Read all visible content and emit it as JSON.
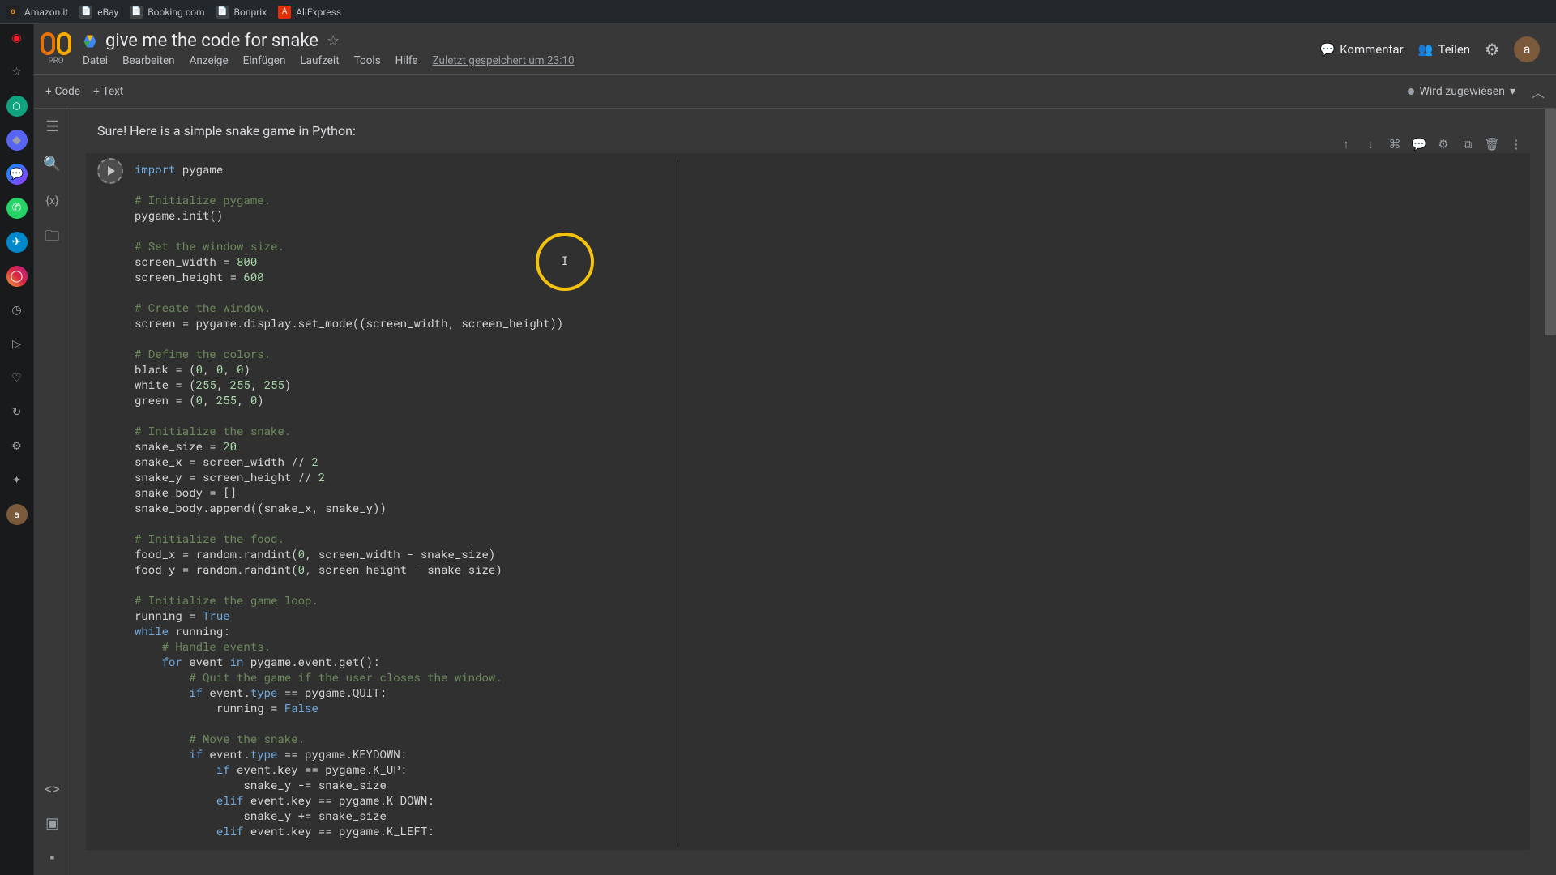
{
  "browser": {
    "bookmarks": [
      {
        "label": "Amazon.it"
      },
      {
        "label": "eBay"
      },
      {
        "label": "Booking.com"
      },
      {
        "label": "Bonprix"
      },
      {
        "label": "AliExpress"
      }
    ]
  },
  "header": {
    "pro_label": "PRO",
    "title": "give me the code for snake",
    "menu": {
      "file": "Datei",
      "edit": "Bearbeiten",
      "view": "Anzeige",
      "insert": "Einfügen",
      "runtime": "Laufzeit",
      "tools": "Tools",
      "help": "Hilfe",
      "autosave": "Zuletzt gespeichert um 23:10"
    },
    "actions": {
      "comment": "Kommentar",
      "share": "Teilen"
    },
    "avatar_letter": "a"
  },
  "toolbar": {
    "add_code": "Code",
    "add_text": "Text",
    "connect_status": "Wird zugewiesen"
  },
  "notebook": {
    "text_cell": "Sure! Here is a simple snake game in Python:",
    "highlight_caret": "I"
  },
  "code": {
    "l1_kw": "import",
    "l1_mod": " pygame",
    "l3": "# Initialize pygame.",
    "l4_a": "pygame.init",
    "l4_b": "()",
    "l6": "# Set the window size.",
    "l7_a": "screen_width ",
    "l7_b": "=",
    "l7_c": " 800",
    "l8_a": "screen_height ",
    "l8_b": "=",
    "l8_c": " 600",
    "l10": "# Create the window.",
    "l11_a": "screen ",
    "l11_b": "=",
    "l11_c": " pygame.display.set_mode",
    "l11_d": "((",
    "l11_e": "screen_width",
    "l11_f": ", ",
    "l11_g": "screen_height",
    "l11_h": "))",
    "l13": "# Define the colors.",
    "l14_a": "black ",
    "l14_b": "=",
    "l14_c": " (",
    "l14_d": "0",
    "l14_e": ", ",
    "l14_f": "0",
    "l14_g": ", ",
    "l14_h": "0",
    "l14_i": ")",
    "l15_a": "white ",
    "l15_b": "=",
    "l15_c": " (",
    "l15_d": "255",
    "l15_e": ", ",
    "l15_f": "255",
    "l15_g": ", ",
    "l15_h": "255",
    "l15_i": ")",
    "l16_a": "green ",
    "l16_b": "=",
    "l16_c": " (",
    "l16_d": "0",
    "l16_e": ", ",
    "l16_f": "255",
    "l16_g": ", ",
    "l16_h": "0",
    "l16_i": ")",
    "l18": "# Initialize the snake.",
    "l19_a": "snake_size ",
    "l19_b": "=",
    "l19_c": " 20",
    "l20_a": "snake_x ",
    "l20_b": "=",
    "l20_c": " screen_width ",
    "l20_d": "//",
    "l20_e": " 2",
    "l21_a": "snake_y ",
    "l21_b": "=",
    "l21_c": " screen_height ",
    "l21_d": "//",
    "l21_e": " 2",
    "l22_a": "snake_body ",
    "l22_b": "=",
    "l22_c": " []",
    "l23_a": "snake_body.append",
    "l23_b": "((",
    "l23_c": "snake_x",
    "l23_d": ", ",
    "l23_e": "snake_y",
    "l23_f": "))",
    "l25": "# Initialize the food.",
    "l26_a": "food_x ",
    "l26_b": "=",
    "l26_c": " random.randint",
    "l26_d": "(",
    "l26_e": "0",
    "l26_f": ", screen_width ",
    "l26_g": "-",
    "l26_h": " snake_size",
    "l26_i": ")",
    "l27_a": "food_y ",
    "l27_b": "=",
    "l27_c": " random.randint",
    "l27_d": "(",
    "l27_e": "0",
    "l27_f": ", screen_height ",
    "l27_g": "-",
    "l27_h": " snake_size",
    "l27_i": ")",
    "l29": "# Initialize the game loop.",
    "l30_a": "running ",
    "l30_b": "=",
    "l30_c": " True",
    "l31_a": "while",
    "l31_b": " running:",
    "l32": "    # Handle events.",
    "l33_a": "    for",
    "l33_b": " event ",
    "l33_c": "in",
    "l33_d": " pygame.event.get",
    "l33_e": "():",
    "l34": "        # Quit the game if the user closes the window.",
    "l35_a": "        if",
    "l35_b": " event.",
    "l35_c": "type",
    "l35_d": " == pygame.QUIT:",
    "l36_a": "            running ",
    "l36_b": "=",
    "l36_c": " False",
    "l38": "        # Move the snake.",
    "l39_a": "        if",
    "l39_b": " event.",
    "l39_c": "type",
    "l39_d": " == pygame.KEYDOWN:",
    "l40_a": "            if",
    "l40_b": " event.key ",
    "l40_c": "==",
    "l40_d": " pygame.K_UP:",
    "l41": "                snake_y -= snake_size",
    "l42_a": "            elif",
    "l42_b": " event.key ",
    "l42_c": "==",
    "l42_d": " pygame.K_DOWN:",
    "l43": "                snake_y += snake_size",
    "l44_a": "            elif",
    "l44_b": " event.key ",
    "l44_c": "==",
    "l44_d": " pygame.K_LEFT:"
  }
}
